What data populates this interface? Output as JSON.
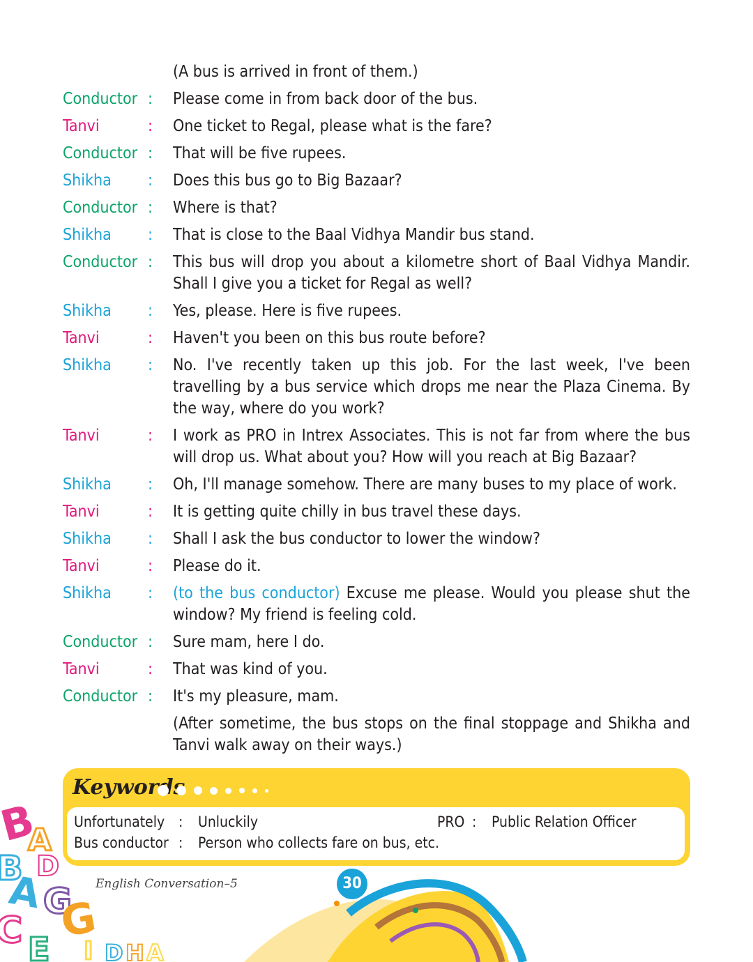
{
  "lines": [
    {
      "speaker": "",
      "colon": "",
      "type": "none",
      "text": "(A bus is arrived in front of them.)"
    },
    {
      "speaker": "Conductor",
      "colon": ":",
      "type": "conductor",
      "text": "Please come in from back door of the bus."
    },
    {
      "speaker": "Tanvi",
      "colon": ":",
      "type": "tanvi",
      "text": "One ticket to Regal, please what is the fare?"
    },
    {
      "speaker": "Conductor",
      "colon": ":",
      "type": "conductor",
      "text": "That will be five rupees."
    },
    {
      "speaker": "Shikha",
      "colon": ":",
      "type": "shikha",
      "text": "Does this bus go to Big Bazaar?"
    },
    {
      "speaker": "Conductor",
      "colon": ":",
      "type": "conductor",
      "text": "Where is that?"
    },
    {
      "speaker": "Shikha",
      "colon": ":",
      "type": "shikha",
      "text": "That is close to the Baal Vidhya Mandir bus stand."
    },
    {
      "speaker": "Conductor",
      "colon": ":",
      "type": "conductor",
      "text": "This bus will drop you about a kilometre short of Baal Vidhya Mandir. Shall I give you a ticket for Regal as well?"
    },
    {
      "speaker": "Shikha",
      "colon": ":",
      "type": "shikha",
      "text": "Yes, please. Here is five rupees."
    },
    {
      "speaker": "Tanvi",
      "colon": ":",
      "type": "tanvi",
      "text": "Haven't you been on this bus route before?"
    },
    {
      "speaker": "Shikha",
      "colon": ":",
      "type": "shikha",
      "text": "No. I've recently taken up this job. For the last week, I've been travelling by a bus service which drops me near the Plaza Cinema. By the way, where do you work?"
    },
    {
      "speaker": "Tanvi",
      "colon": ":",
      "type": "tanvi",
      "text": "I work as PRO in Intrex Associates. This is not far from where the bus will drop us. What about you? How will you reach at Big Bazaar?"
    },
    {
      "speaker": "Shikha",
      "colon": ":",
      "type": "shikha",
      "text": "Oh, I'll manage somehow. There are many buses to my place of work."
    },
    {
      "speaker": "Tanvi",
      "colon": ":",
      "type": "tanvi",
      "text": "It is getting quite chilly in bus travel these days."
    },
    {
      "speaker": "Shikha",
      "colon": ":",
      "type": "shikha",
      "text": "Shall I ask the bus conductor to lower the window?"
    },
    {
      "speaker": "Tanvi",
      "colon": ":",
      "type": "tanvi",
      "text": "Please do it."
    },
    {
      "speaker": "Shikha",
      "colon": ":",
      "type": "shikha",
      "aside": "(to the bus conductor)",
      "text": " Excuse me please. Would you please shut the window? My friend is feeling cold."
    },
    {
      "speaker": "Conductor",
      "colon": ":",
      "type": "conductor",
      "text": "Sure mam, here I do."
    },
    {
      "speaker": "Tanvi",
      "colon": ":",
      "type": "tanvi",
      "text": "That was kind of you."
    },
    {
      "speaker": "Conductor",
      "colon": ":",
      "type": "conductor",
      "text": "It's my pleasure, mam."
    },
    {
      "speaker": "",
      "colon": "",
      "type": "none",
      "text": "(After sometime, the bus stops on the final stoppage and Shikha and Tanvi walk away on their ways.)"
    }
  ],
  "keywords": {
    "title": "Keywords",
    "items": [
      {
        "term": "Unfortunately",
        "sep": ":",
        "meaning": "Unluckily"
      },
      {
        "term": "PRO",
        "sep": ":",
        "meaning": "Public Relation Officer"
      },
      {
        "term": "Bus conductor",
        "sep": ":",
        "meaning": "Person who collects fare on bus, etc."
      }
    ]
  },
  "footer": {
    "book_title": "English Conversation–5",
    "page_number": "30"
  },
  "colors": {
    "conductor": "#0aa36a",
    "tanvi": "#e0197d",
    "shikha": "#1aa3d9",
    "keyword_band": "#fdd431"
  }
}
